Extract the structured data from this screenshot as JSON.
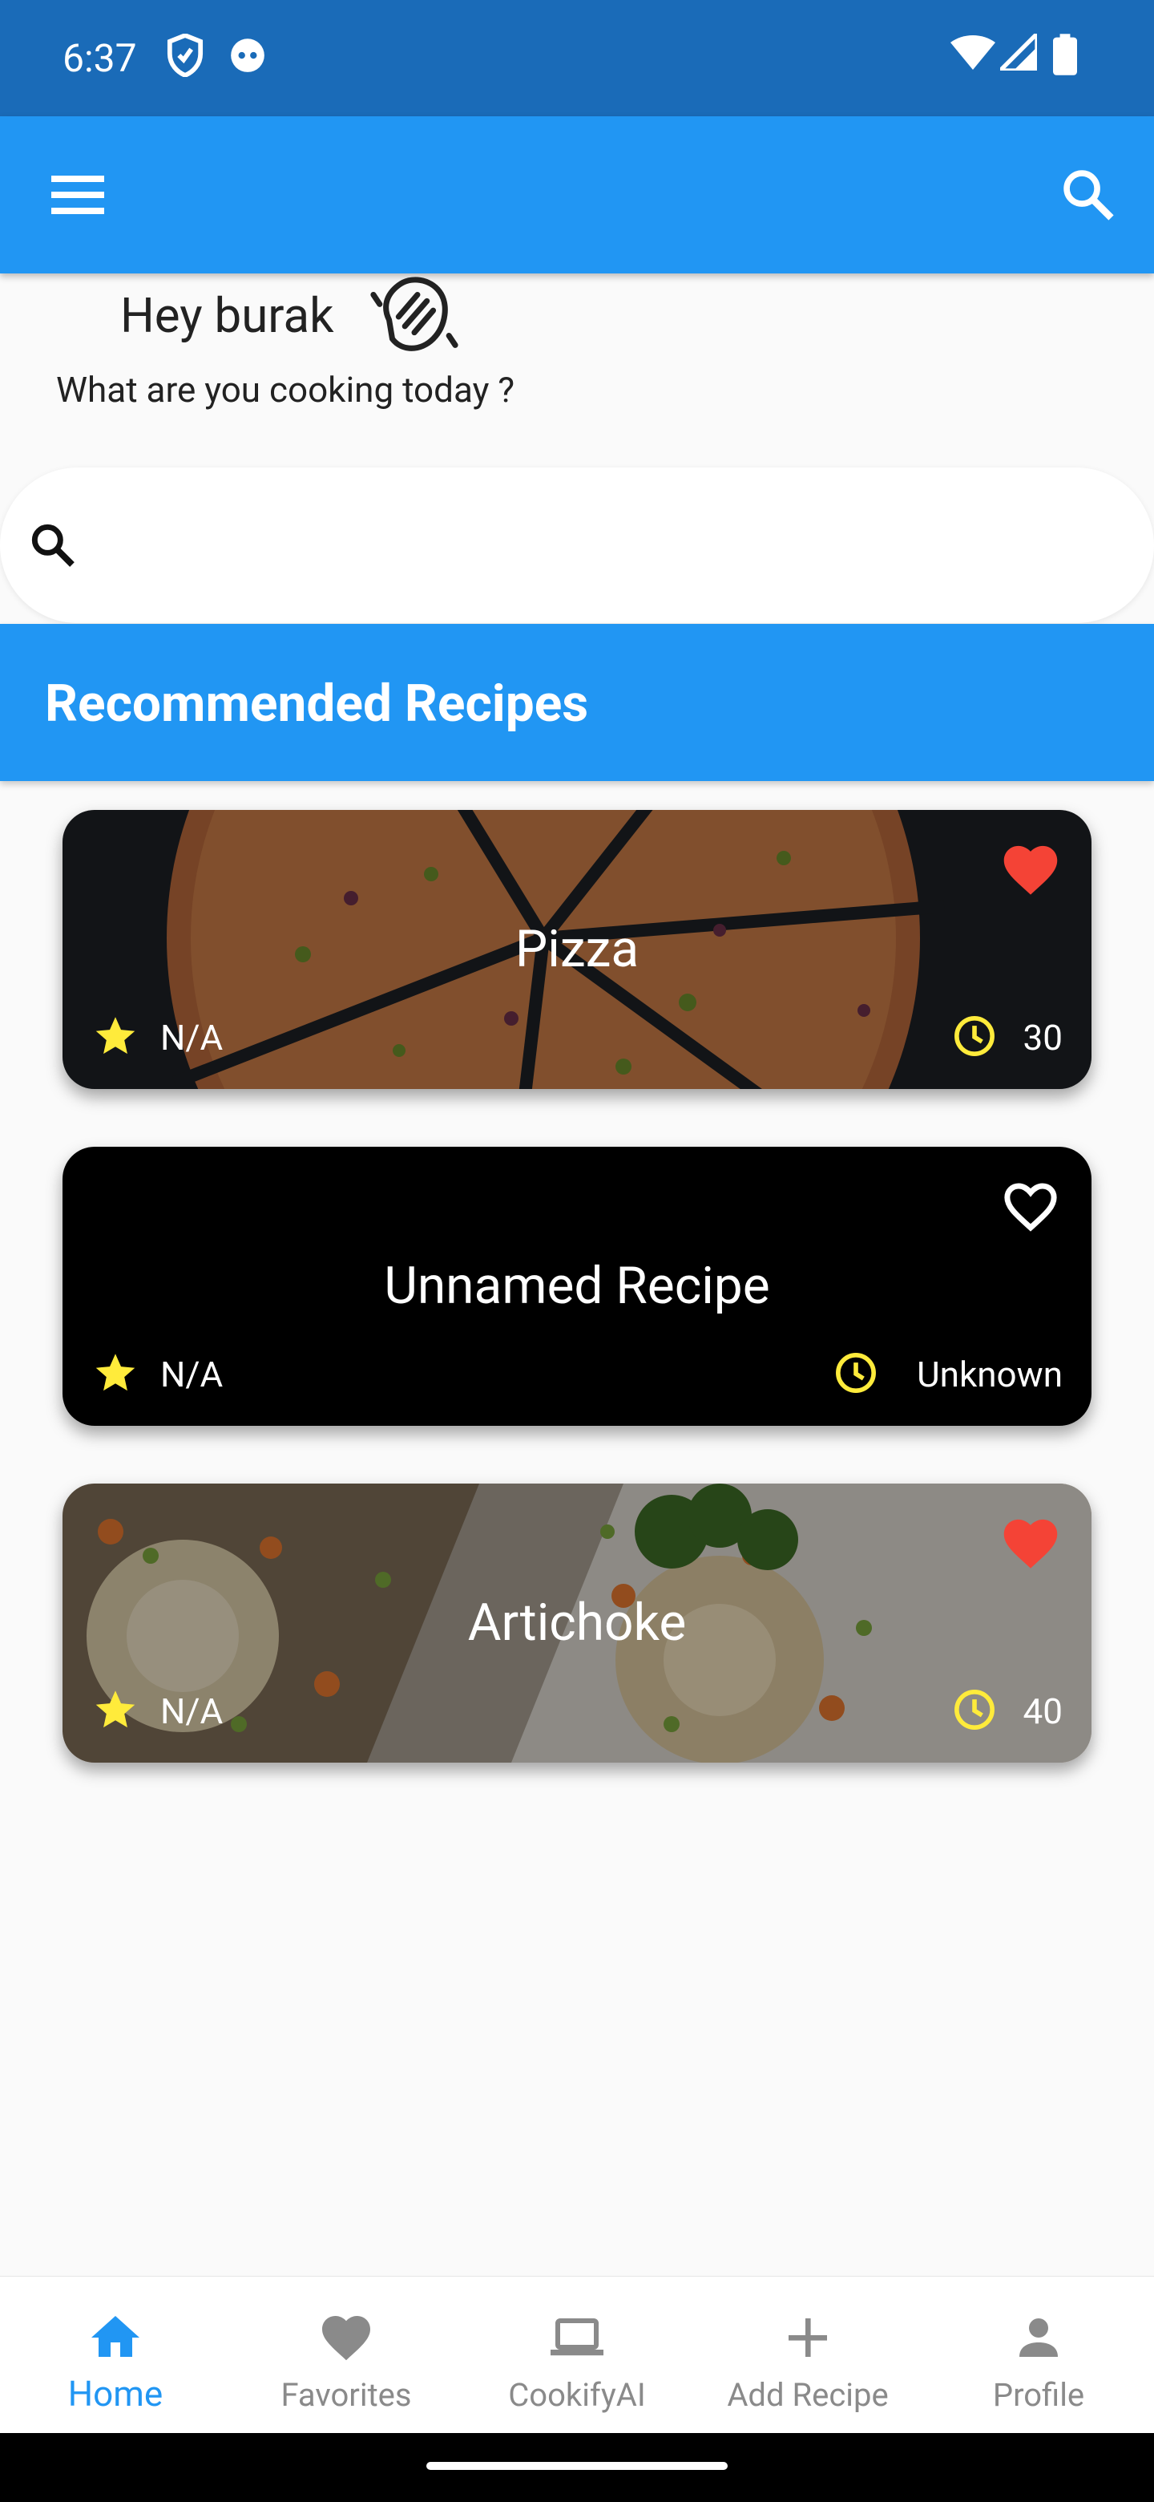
{
  "status_bar": {
    "time": "6:37"
  },
  "greeting": {
    "hello": "Hey burak",
    "question": "What are you cooking today ?"
  },
  "search": {
    "placeholder": ""
  },
  "section": {
    "title": "Recommended Recipes"
  },
  "recipes": [
    {
      "name": "Pizza",
      "rating": "N/A",
      "time": "30",
      "favorite": true
    },
    {
      "name": "Unnamed Recipe",
      "rating": "N/A",
      "time": "Unknown",
      "favorite": false
    },
    {
      "name": "Artichoke",
      "rating": "N/A",
      "time": "40",
      "favorite": true
    }
  ],
  "bottom_nav": [
    {
      "label": "Home",
      "icon": "home-icon",
      "active": true
    },
    {
      "label": "Favorites",
      "icon": "heart-icon",
      "active": false
    },
    {
      "label": "CookifyAI",
      "icon": "laptop-icon",
      "active": false
    },
    {
      "label": "Add Recipe",
      "icon": "plus-icon",
      "active": false
    },
    {
      "label": "Profile",
      "icon": "person-icon",
      "active": false
    }
  ],
  "colors": {
    "primary": "#2196f3",
    "status_bar": "#1a6bb8",
    "favorite_red": "#f44336",
    "star_yellow": "#ffeb3b"
  }
}
